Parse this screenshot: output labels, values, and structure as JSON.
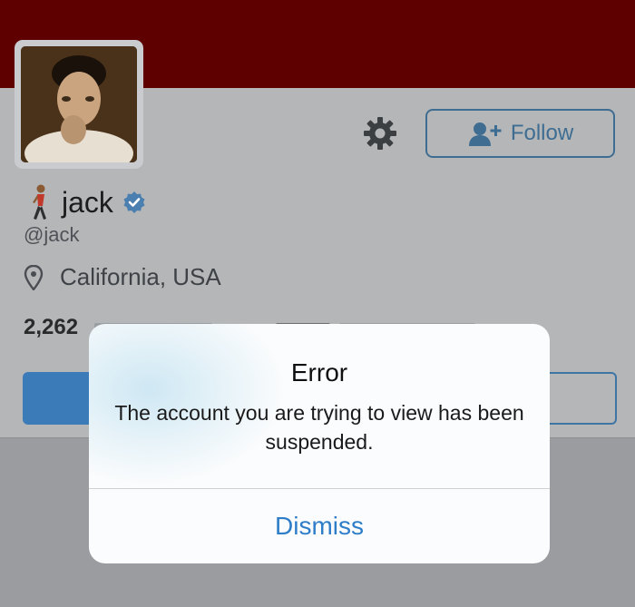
{
  "profile": {
    "display_name": "jack",
    "handle": "@jack",
    "location": "California, USA",
    "following_count": "2,262",
    "follow_label": "Follow"
  },
  "dialog": {
    "title": "Error",
    "message": "The account you are trying to view has been suspended.",
    "dismiss_label": "Dismiss"
  },
  "icons": {
    "gear": "gear-icon",
    "follow": "add-user-icon",
    "walker": "walking-emoji-icon",
    "verified": "verified-badge-icon",
    "location": "location-pin-icon"
  },
  "colors": {
    "banner": "#5e0000",
    "accent": "#3f6d92",
    "dismiss": "#2e7dc9",
    "verified": "#4a7fb0"
  }
}
